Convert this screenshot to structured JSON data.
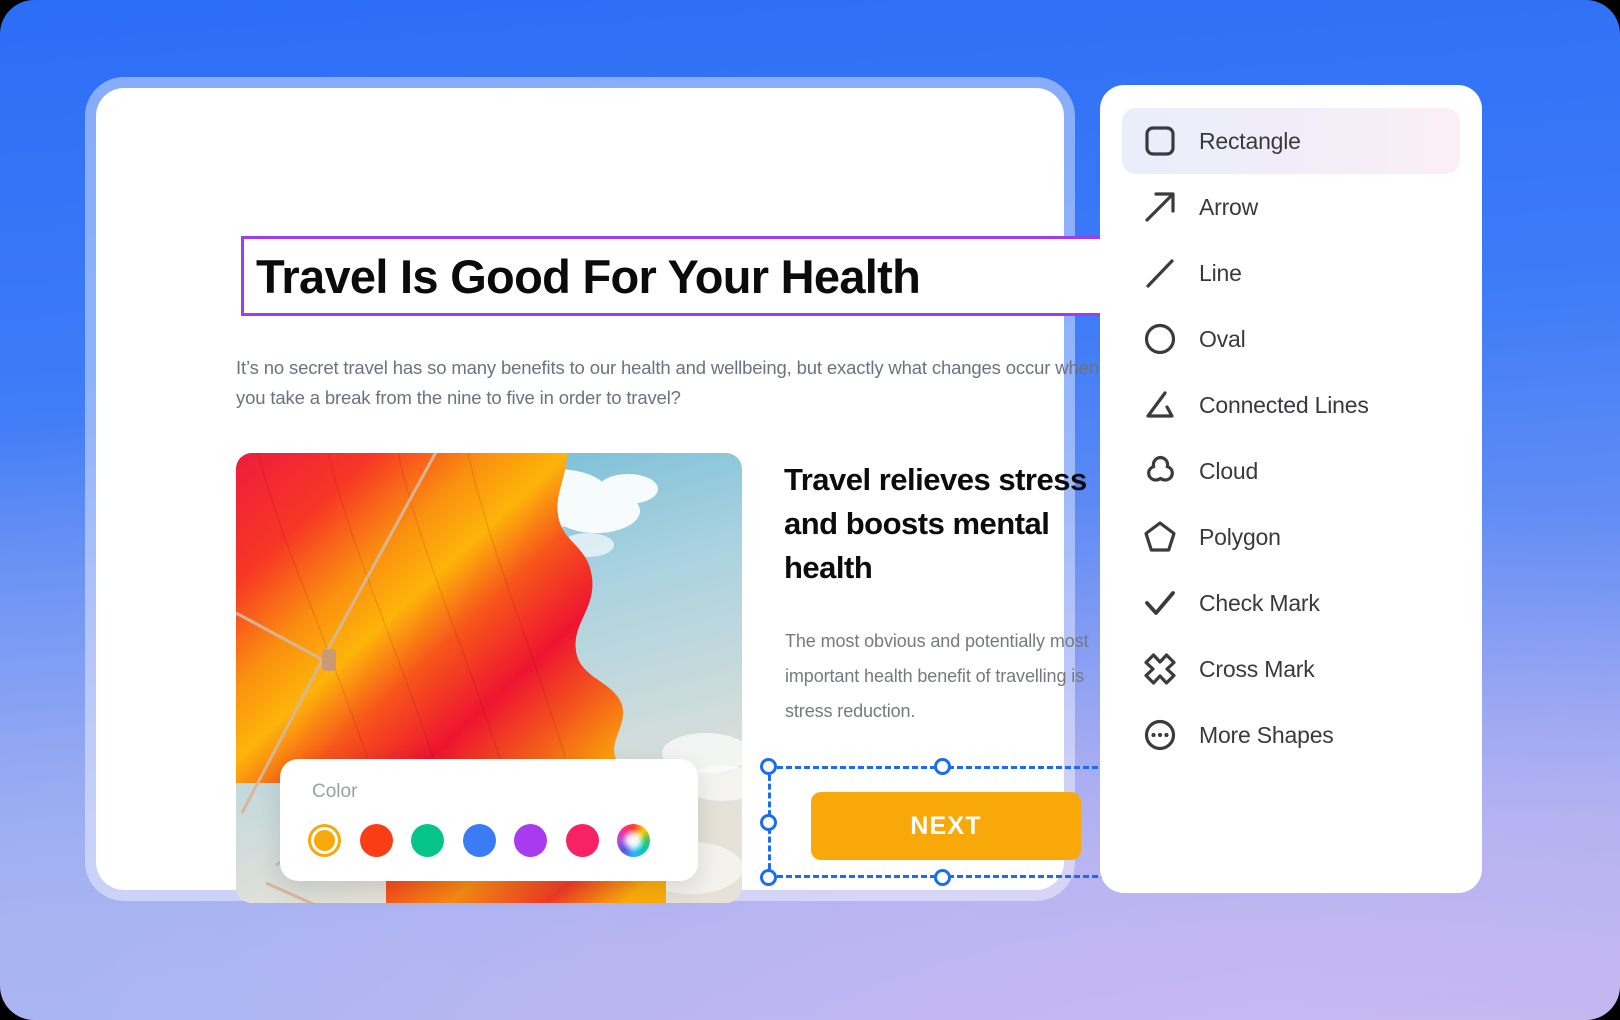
{
  "background": {
    "gradient_from": "#2c6df6",
    "gradient_to": "#bdb6ef"
  },
  "editor": {
    "title": "Travel Is Good For Your Health",
    "title_selection_color": "#a13cf5",
    "intro_paragraph": "It’s no secret travel has so many benefits to our health and wellbeing, but exactly what changes occur when you take a break from the nine to five in order to travel?",
    "sub_heading": "Travel relieves stress and boosts mental health",
    "sub_paragraph": "The most obvious and potentially most important health benefit of travelling is stress reduction.",
    "photo_alt": "hot-air-balloon-fabric-against-blue-sky"
  },
  "color_popover": {
    "label": "Color",
    "swatches": [
      {
        "name": "orange",
        "hex": "#f9a80a",
        "selected": true
      },
      {
        "name": "red",
        "hex": "#f93d14",
        "selected": false
      },
      {
        "name": "teal",
        "hex": "#04c48a",
        "selected": false
      },
      {
        "name": "blue",
        "hex": "#3b7bf5",
        "selected": false
      },
      {
        "name": "purple",
        "hex": "#a83bee",
        "selected": false
      },
      {
        "name": "pink",
        "hex": "#f72265",
        "selected": false
      },
      {
        "name": "rainbow",
        "hex": "rainbow",
        "selected": false
      }
    ]
  },
  "next_button": {
    "label": "NEXT",
    "fill": "#f9a80a",
    "selected": true,
    "selection_color": "#1a6cf0",
    "handles": 8
  },
  "shapes_panel": {
    "items": [
      {
        "label": "Rectangle",
        "icon": "rectangle-icon",
        "active": true
      },
      {
        "label": "Arrow",
        "icon": "arrow-icon",
        "active": false
      },
      {
        "label": "Line",
        "icon": "line-icon",
        "active": false
      },
      {
        "label": "Oval",
        "icon": "oval-icon",
        "active": false
      },
      {
        "label": "Connected Lines",
        "icon": "connected-lines-icon",
        "active": false
      },
      {
        "label": "Cloud",
        "icon": "cloud-icon",
        "active": false
      },
      {
        "label": "Polygon",
        "icon": "polygon-icon",
        "active": false
      },
      {
        "label": "Check Mark",
        "icon": "check-mark-icon",
        "active": false
      },
      {
        "label": "Cross Mark",
        "icon": "cross-mark-icon",
        "active": false
      },
      {
        "label": "More Shapes",
        "icon": "more-shapes-icon",
        "active": false
      }
    ]
  }
}
